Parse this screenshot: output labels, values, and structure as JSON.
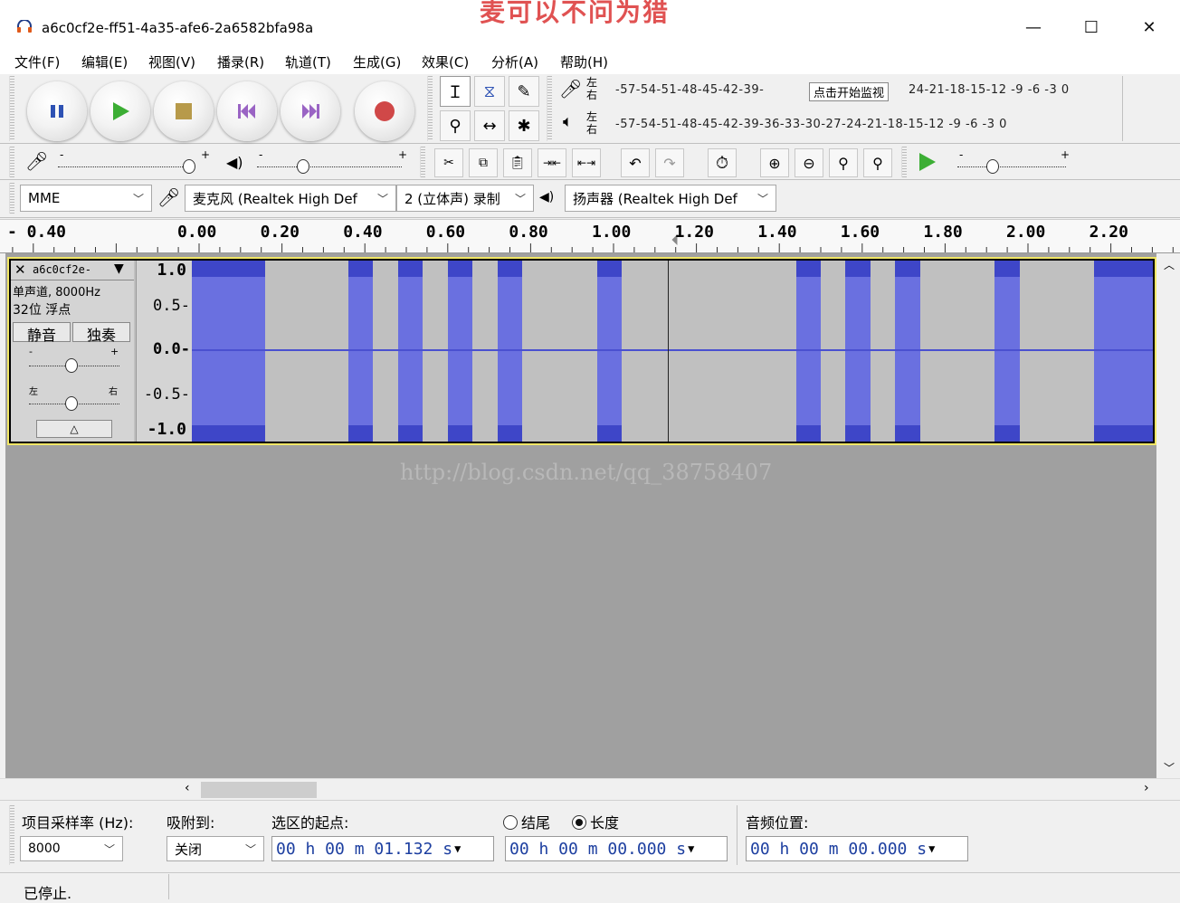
{
  "window": {
    "title": "a6c0cf2e-ff51-4a35-afe6-2a6582bfa98a",
    "watermark_top": "麦可以不问为猎",
    "minimize": "—",
    "maximize": "☐",
    "close": "✕"
  },
  "menu": [
    "文件(F)",
    "编辑(E)",
    "视图(V)",
    "播录(R)",
    "轨道(T)",
    "生成(G)",
    "效果(C)",
    "分析(A)",
    "帮助(H)"
  ],
  "meters": {
    "rec_channel_top": "左",
    "rec_channel_bottom": "右",
    "play_channel_top": "左",
    "play_channel_bottom": "右",
    "rec_scale_left": "-57-54-51-48-45-42-39-",
    "rec_monitor_label": "点击开始监视",
    "rec_scale_right": "24-21-18-15-12 -9  -6  -3  0",
    "play_scale": "-57-54-51-48-45-42-39-36-33-30-27-24-21-18-15-12 -9  -6  -3  0"
  },
  "mixer": {
    "rec_minus": "-",
    "rec_plus": "+",
    "play_minus": "-",
    "play_plus": "+",
    "speed_minus": "-",
    "speed_plus": "+"
  },
  "devices": {
    "host": "MME",
    "mic": "麦克风 (Realtek High Def",
    "channels": "2 (立体声) 录制",
    "speaker": "扬声器 (Realtek High Def"
  },
  "ruler": {
    "ticks": [
      "- 0.40",
      "0.00",
      "0.20",
      "0.40",
      "0.60",
      "0.80",
      "1.00",
      "1.20",
      "1.40",
      "1.60",
      "1.80",
      "2.00",
      "2.20"
    ]
  },
  "track": {
    "name": "a6c0cf2e-",
    "info_line1": "单声道, 8000Hz",
    "info_line2": "32位 浮点",
    "mute": "静音",
    "solo": "独奏",
    "gain_minus": "-",
    "gain_plus": "+",
    "pan_left": "左",
    "pan_right": "右",
    "collapse": "△",
    "scale": [
      "1.0",
      "0.5-",
      "0.0-",
      "-0.5-",
      "-1.0"
    ],
    "cursor_time": 1.132,
    "duration": 2.3,
    "bursts": [
      {
        "start": -0.02,
        "end": 0.16
      },
      {
        "start": 0.36,
        "end": 0.42
      },
      {
        "start": 0.48,
        "end": 0.54
      },
      {
        "start": 0.6,
        "end": 0.66
      },
      {
        "start": 0.72,
        "end": 0.78
      },
      {
        "start": 0.96,
        "end": 1.02
      },
      {
        "start": 1.44,
        "end": 1.5
      },
      {
        "start": 1.56,
        "end": 1.62
      },
      {
        "start": 1.68,
        "end": 1.74
      },
      {
        "start": 1.92,
        "end": 1.98
      },
      {
        "start": 2.16,
        "end": 2.32
      }
    ]
  },
  "watermark_mid": "http://blog.csdn.net/qq_38758407",
  "selection": {
    "rate_label": "项目采样率 (Hz):",
    "rate_value": "8000",
    "snap_label": "吸附到:",
    "snap_value": "关闭",
    "start_label": "选区的起点:",
    "end_option": "结尾",
    "length_option": "长度",
    "start_time": "00 h 00 m 01.132 s",
    "length_time": "00 h 00 m 00.000 s",
    "audio_pos_label": "音频位置:",
    "audio_pos_time": "00 h 00 m 00.000 s"
  },
  "status": "已停止."
}
